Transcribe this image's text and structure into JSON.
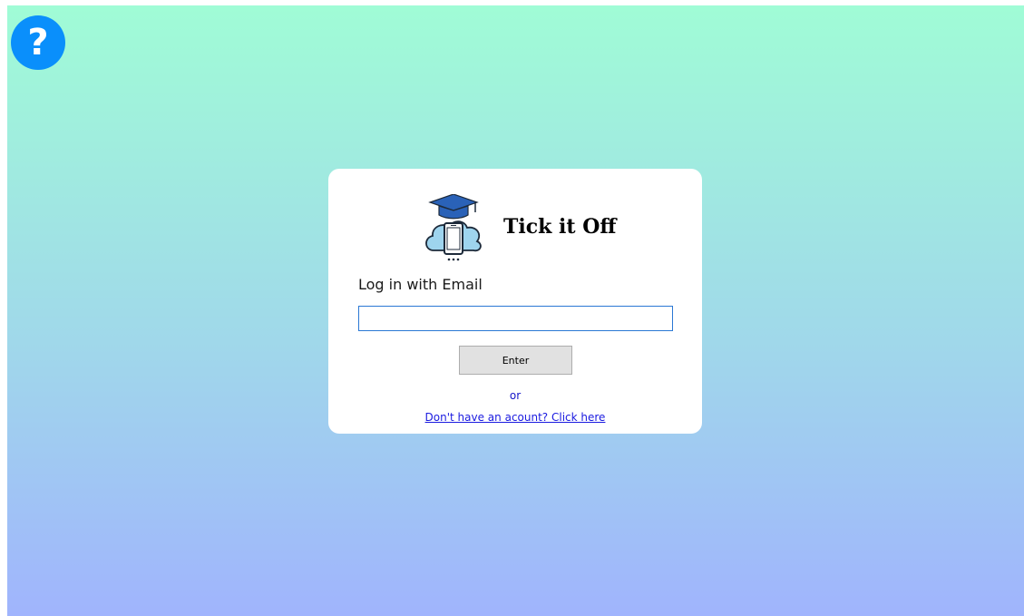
{
  "help": {
    "icon": "question-mark-icon",
    "glyph": "?",
    "color": "#0a8ffb"
  },
  "login": {
    "logo_icon": "graduation-cap-cloud-phone-icon",
    "app_title": "Tick it Off",
    "label": "Log in with Email",
    "email_value": "",
    "enter_label": "Enter",
    "or_text": "or",
    "signup_link": "Don't have an acount? Click here"
  },
  "colors": {
    "background_top": "#a0fcd6",
    "background_bottom": "#a0b4fd",
    "logo_cap": "#2a62b8",
    "logo_cloud": "#9ed4ee",
    "link": "#1a1ae0",
    "input_border": "#2a78d4"
  }
}
